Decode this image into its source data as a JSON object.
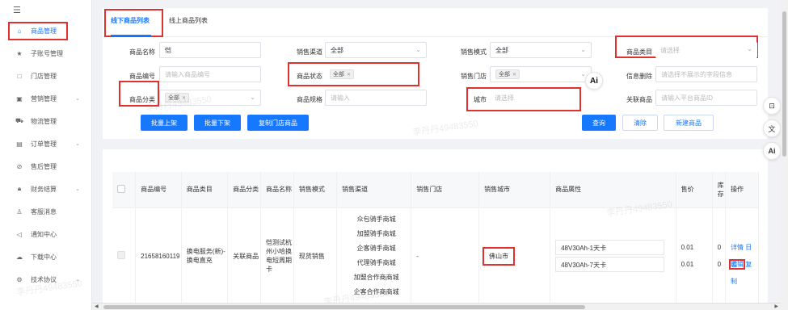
{
  "sidebar": {
    "collapse_icon": "menu-fold-icon",
    "items": [
      {
        "label": "商品管理",
        "icon": "home-icon"
      },
      {
        "label": "子账号管理",
        "icon": "star-icon"
      },
      {
        "label": "门店管理",
        "icon": "square-icon"
      },
      {
        "label": "营销管理",
        "icon": "wallet-icon"
      },
      {
        "label": "物流管理",
        "icon": "truck-icon"
      },
      {
        "label": "订单管理",
        "icon": "order-icon"
      },
      {
        "label": "售后管理",
        "icon": "check-circle-icon"
      },
      {
        "label": "财务结算",
        "icon": "lock-icon"
      },
      {
        "label": "客服消息",
        "icon": "user-icon"
      },
      {
        "label": "通知中心",
        "icon": "speaker-icon"
      },
      {
        "label": "下载中心",
        "icon": "cloud-icon"
      },
      {
        "label": "技术协议",
        "icon": "gear-icon"
      }
    ]
  },
  "tabs": [
    "线下商品列表",
    "线上商品列表"
  ],
  "filters": {
    "name_label": "商品名称",
    "name_value": "恺",
    "channel_label": "销售渠道",
    "channel_value": "全部",
    "mode_label": "销售模式",
    "mode_value": "全部",
    "category_label": "商品类目",
    "category_placeholder": "请选择",
    "code_label": "商品编号",
    "code_placeholder": "请输入商品编号",
    "status_label": "商品状态",
    "status_tag": "全部",
    "store_label": "销售门店",
    "store_tag": "全部",
    "info_delete_label": "信息删除",
    "info_delete_placeholder": "请选择不展示的字段信息",
    "class_label": "商品分类",
    "class_tag": "全部",
    "spec_label": "商品规格",
    "spec_placeholder": "请输入",
    "city_label": "城市",
    "city_placeholder": "请选择",
    "related_label": "关联商品",
    "related_placeholder": "请输入平台商品ID"
  },
  "buttons": {
    "batch_on": "批量上架",
    "batch_off": "批量下架",
    "copy_store": "复制门店商品",
    "query": "查询",
    "clear": "清除",
    "new": "新建商品"
  },
  "table": {
    "headers": [
      "商品编号",
      "商品类目",
      "商品分类",
      "商品名称",
      "销售模式",
      "销售渠道",
      "销售门店",
      "销售城市",
      "商品属性",
      "售价",
      "库存",
      "操作"
    ],
    "row": {
      "code": "21658160119",
      "category": "换电服务(新)-换电直充",
      "class": "关联商品",
      "name": "恺测试杭州小哈换电短周期卡",
      "mode": "现货销售",
      "channels": [
        "众包骑手商城",
        "加盟骑手商城",
        "企客骑手商城",
        "代理骑手商城",
        "加盟合作商商城",
        "企客合作商商城"
      ],
      "store": "-",
      "city": "佛山市",
      "attrs": [
        "48V30Ah-1天卡",
        "48V30Ah-7天卡"
      ],
      "prices": [
        "0.01",
        "0.01"
      ],
      "stock": [
        "0",
        "0"
      ],
      "ops": {
        "detail": "详情",
        "log": "日志",
        "edit": "编辑",
        "copy": "复制"
      }
    }
  },
  "watermark": "李丹丹49483550",
  "ai_label": "Ai"
}
